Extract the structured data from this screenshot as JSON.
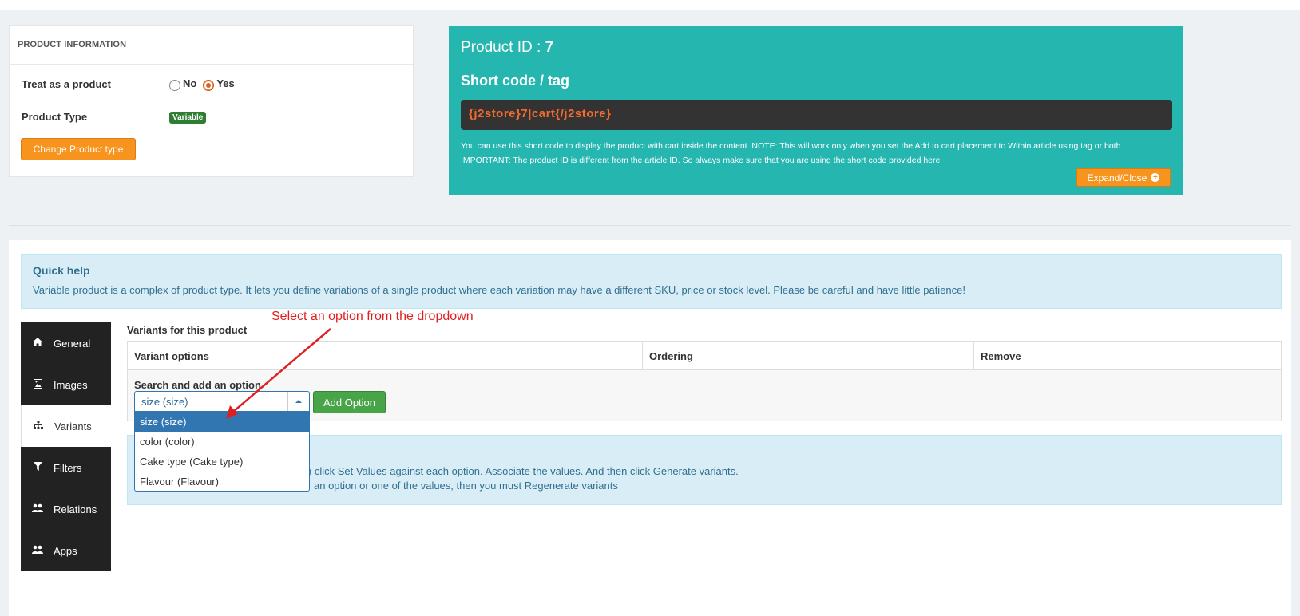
{
  "product_info": {
    "header": "PRODUCT INFORMATION",
    "treat_label": "Treat as a product",
    "radio_no": "No",
    "radio_yes": "Yes",
    "type_label": "Product Type",
    "type_badge": "Variable",
    "change_button": "Change Product type"
  },
  "shortcode_panel": {
    "product_id_label": "Product ID :",
    "product_id_value": "7",
    "title": "Short code / tag",
    "code": "{j2store}7|cart{/j2store}",
    "note_line1": "You can use this short code to display the product with cart inside the content. NOTE: This will work only when you set the Add to cart placement to Within article using tag or both.",
    "note_line2": "IMPORTANT: The product ID is different from the article ID. So always make sure that you are using the short code provided here",
    "expand_button": "Expand/Close",
    "accent_color": "#26b6b0"
  },
  "quick_help": {
    "title": "Quick help",
    "text": "Variable product is a complex of product type. It lets you define variations of a single product where each variation may have a different SKU, price or stock level. Please be careful and have little patience!"
  },
  "tabs": [
    {
      "label": "General",
      "icon": "home-icon"
    },
    {
      "label": "Images",
      "icon": "image-icon"
    },
    {
      "label": "Variants",
      "icon": "sitemap-icon",
      "active": true
    },
    {
      "label": "Filters",
      "icon": "filter-icon"
    },
    {
      "label": "Relations",
      "icon": "users-icon"
    },
    {
      "label": "Apps",
      "icon": "users-icon"
    }
  ],
  "variants": {
    "title": "Variants for this product",
    "col_options": "Variant options",
    "col_ordering": "Ordering",
    "col_remove": "Remove",
    "search_label": "Search and add an option",
    "selected_value": "size (size)",
    "add_button": "Add Option",
    "dropdown_options": [
      "size (size)",
      "color (color)",
      "Cake type (Cake type)",
      "Flavour (Flavour)"
    ]
  },
  "info_box": {
    "line1": "n click Set Values against each option. Associate the values. And then click Generate variants.",
    "line2": "an option or one of the values, then you must Regenerate variants"
  },
  "annotation": "Select an option from the dropdown"
}
